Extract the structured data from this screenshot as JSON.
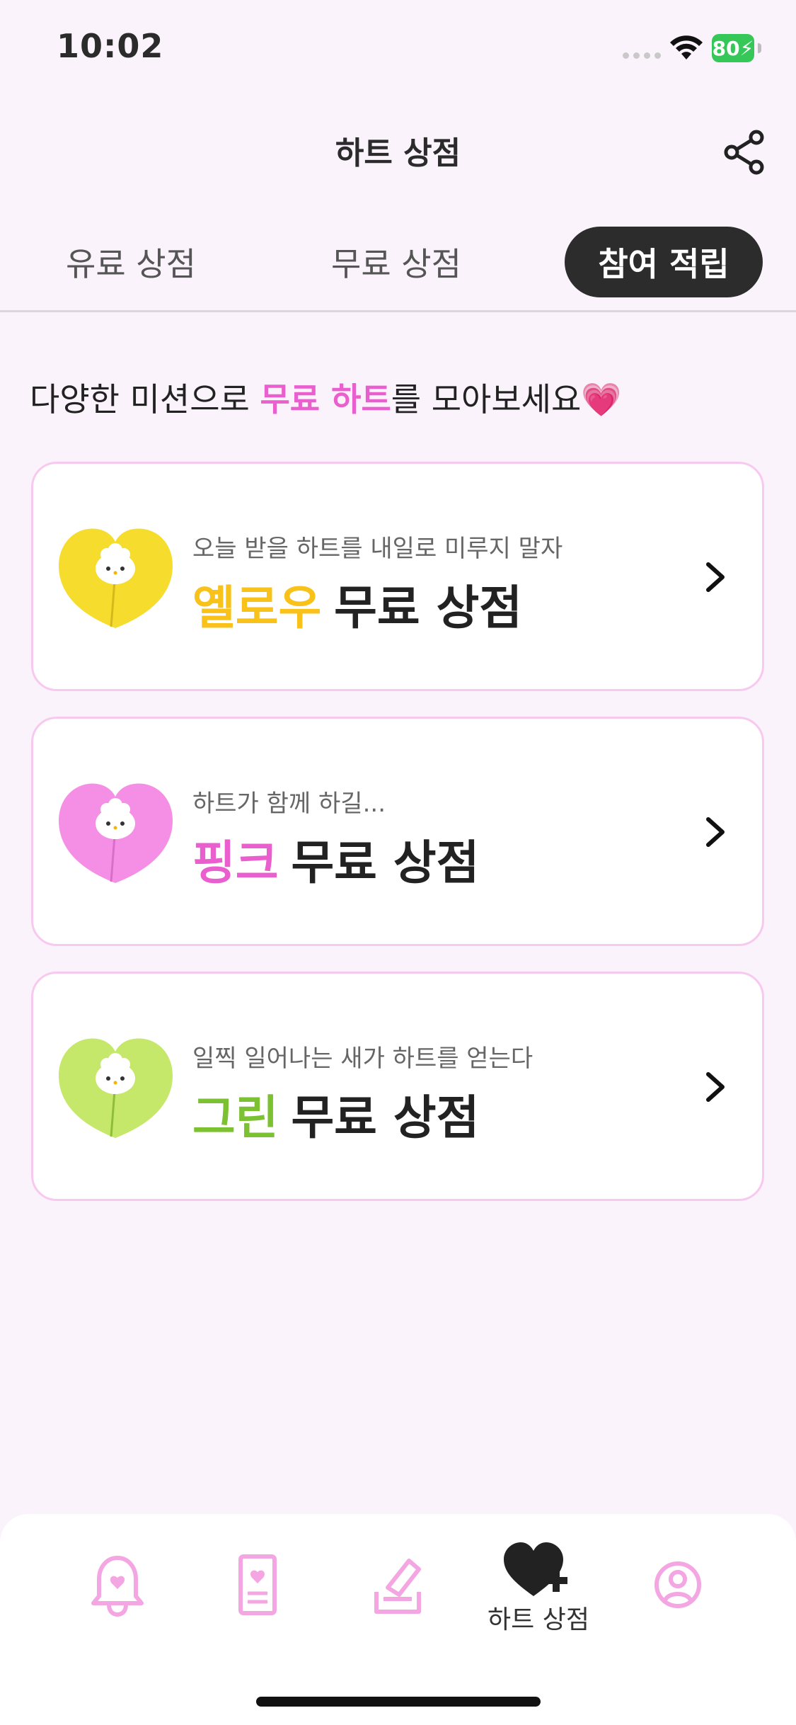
{
  "status_bar": {
    "time": "10:02",
    "battery": "80"
  },
  "header": {
    "title": "하트 상점"
  },
  "tabs": [
    {
      "label": "유료 상점"
    },
    {
      "label": "무료 상점"
    },
    {
      "label": "참여 적립",
      "active": true
    }
  ],
  "intro": {
    "before": "다양한 미션으로 ",
    "highlight": "무료 하트",
    "after": "를 모아보세요💗"
  },
  "cards": [
    {
      "subtitle": "오늘 받을 하트를 내일로 미루지 말자",
      "color_word": "옐로우",
      "rest": "무료 상점",
      "color": "#f8c21a",
      "icon": "yellow-heart-icon"
    },
    {
      "subtitle": "하트가 함께 하길...",
      "color_word": "핑크",
      "rest": "무료 상점",
      "color": "#ea5fce",
      "icon": "pink-heart-icon"
    },
    {
      "subtitle": "일찍 일어나는 새가 하트를 얻는다",
      "color_word": "그린",
      "rest": "무료 상점",
      "color": "#7cc132",
      "icon": "green-heart-icon"
    }
  ],
  "bottom_nav": {
    "items": [
      {
        "icon": "bell-icon"
      },
      {
        "icon": "card-icon"
      },
      {
        "icon": "write-icon"
      },
      {
        "icon": "heart-plus-icon",
        "label": "하트 상점",
        "active": true
      },
      {
        "icon": "profile-icon"
      }
    ]
  }
}
